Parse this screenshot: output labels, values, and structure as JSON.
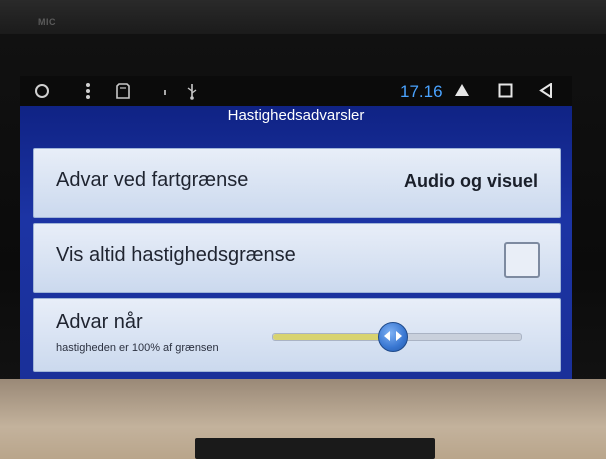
{
  "device": {
    "mic_label": "MIC"
  },
  "status_bar": {
    "time": "17.16",
    "left_icons": [
      "circle-icon",
      "more-vert-icon",
      "sd-card-icon",
      "notification-dot-icon",
      "usb-icon"
    ],
    "right_icons": [
      "home-triangle-icon",
      "recents-square-icon",
      "back-icon"
    ]
  },
  "screen": {
    "title": "Hastighedsadvarsler",
    "rows": [
      {
        "label": "Advar ved fartgrænse",
        "value": "Audio og visuel"
      },
      {
        "label": "Vis altid hastighedsgrænse",
        "checked": false
      },
      {
        "label": "Advar når",
        "sublabel": "hastigheden er 100% af grænsen",
        "slider_fraction": 0.48
      }
    ]
  },
  "colors": {
    "screen_bg": "#1c34a4",
    "row_bg": "#e8eef8",
    "clock": "#4aa3ff",
    "slider_fill": "#d8d370",
    "slider_thumb": "#3876d1"
  }
}
